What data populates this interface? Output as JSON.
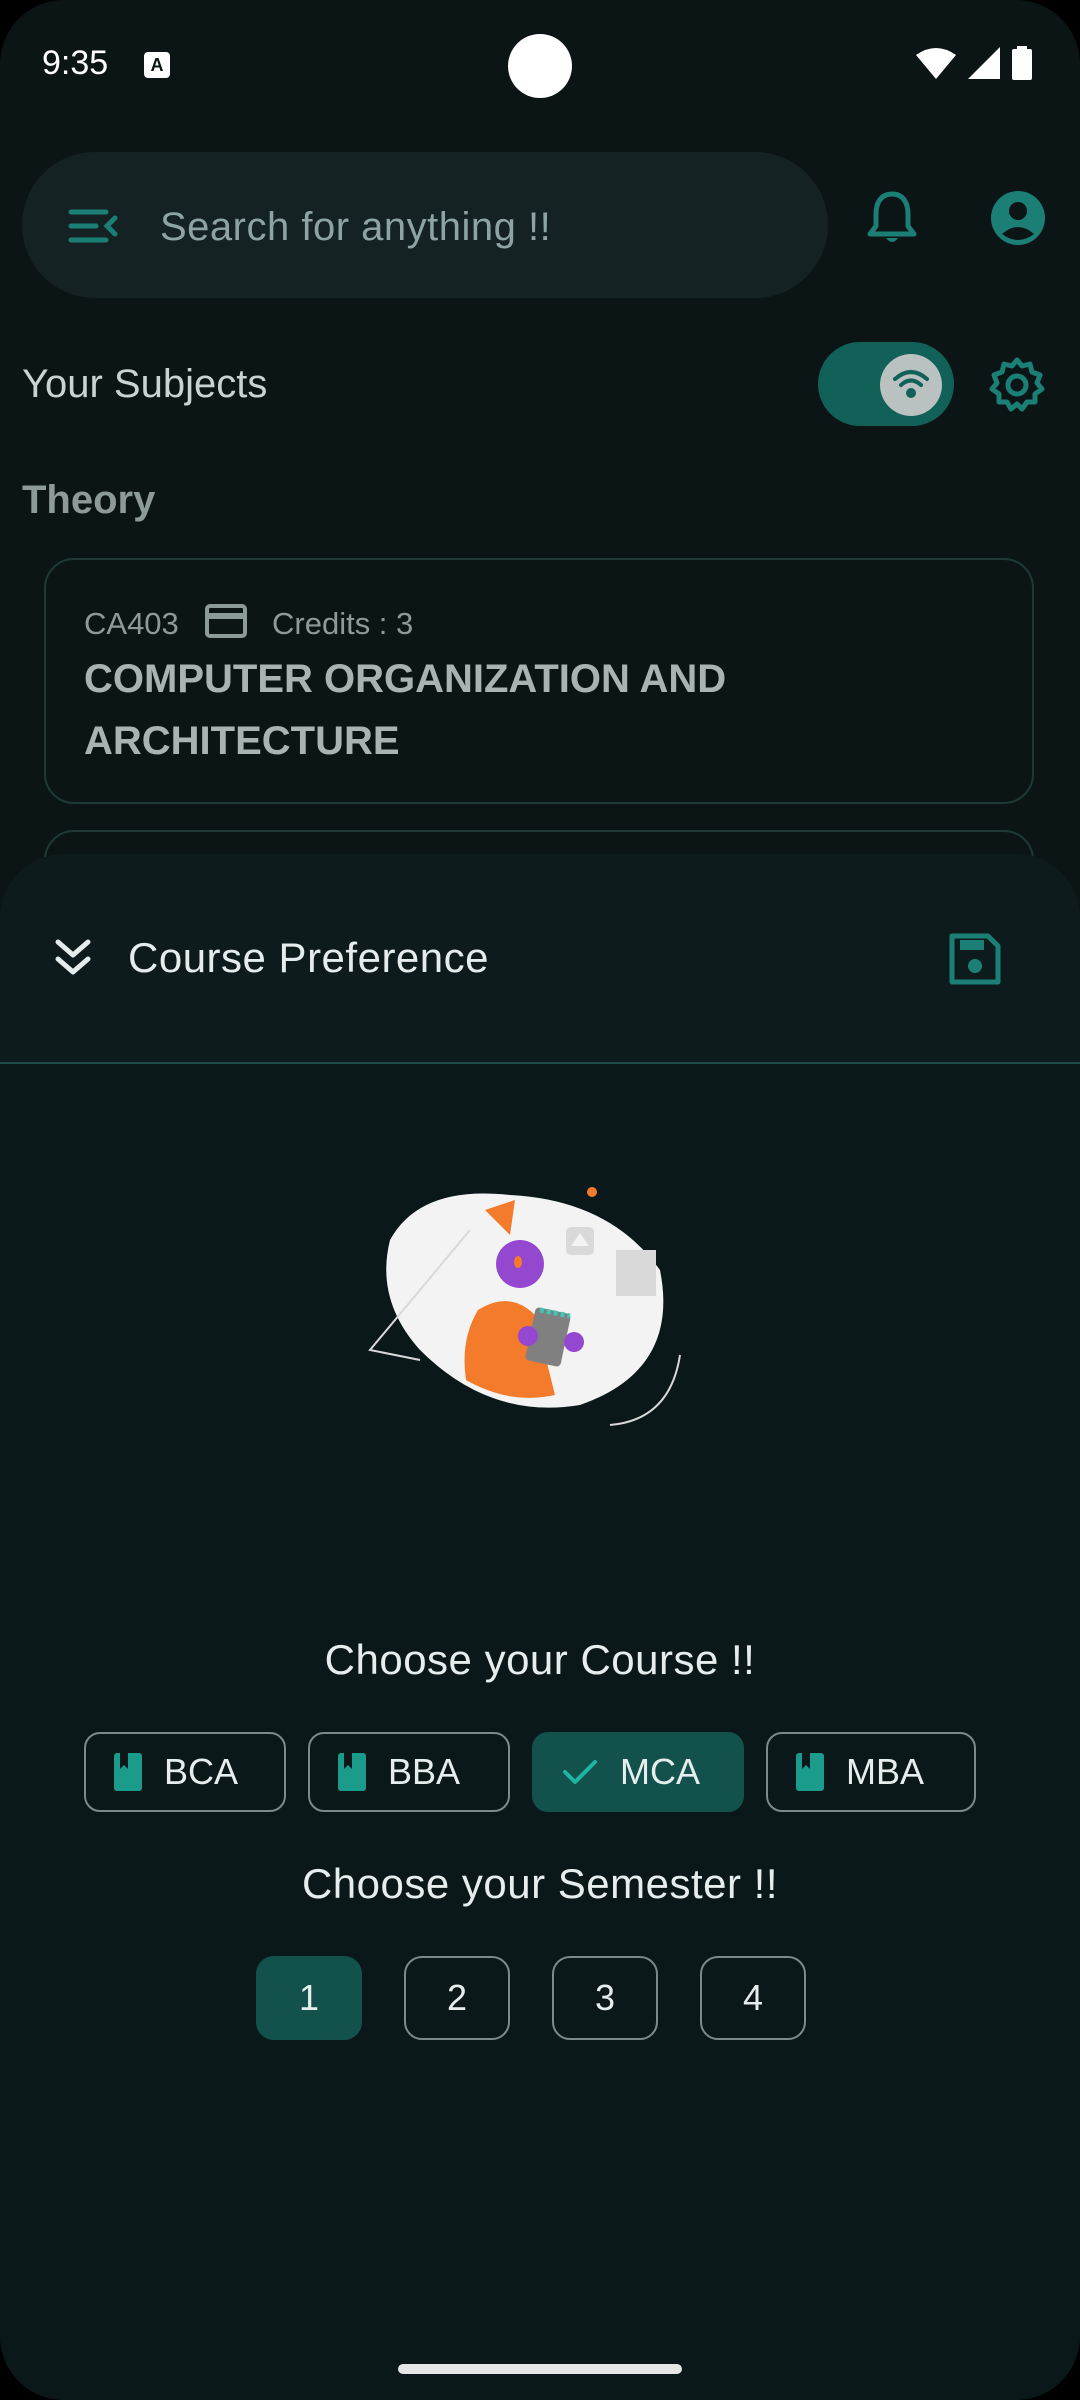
{
  "status_bar": {
    "time": "9:35",
    "notification_glyph": "A"
  },
  "search": {
    "placeholder": "Search for anything !!"
  },
  "header": {
    "section_title": "Your Subjects",
    "offline_toggle_on": true
  },
  "subjects": {
    "group_label": "Theory",
    "cards": [
      {
        "code": "CA403",
        "credits": "Credits : 3",
        "title": "COMPUTER ORGANIZATION AND ARCHITECTURE"
      }
    ]
  },
  "sheet": {
    "title": "Course Preference",
    "course_prompt": "Choose your Course !!",
    "courses": [
      {
        "label": "BCA",
        "selected": false
      },
      {
        "label": "BBA",
        "selected": false
      },
      {
        "label": "MCA",
        "selected": true
      },
      {
        "label": "MBA",
        "selected": false
      }
    ],
    "semester_prompt": "Choose your Semester !!",
    "semesters": [
      {
        "label": "1",
        "selected": true
      },
      {
        "label": "2",
        "selected": false
      },
      {
        "label": "3",
        "selected": false
      },
      {
        "label": "4",
        "selected": false
      }
    ]
  },
  "colors": {
    "accent": "#12514c",
    "background": "#0c1516",
    "icon_teal": "#1b7f75"
  },
  "icons": [
    "menu-open-icon",
    "bell-icon",
    "account-circle-icon",
    "wifi-icon",
    "gear-icon",
    "credit-card-icon",
    "double-chevron-down-icon",
    "save-icon",
    "book-icon",
    "check-icon"
  ]
}
